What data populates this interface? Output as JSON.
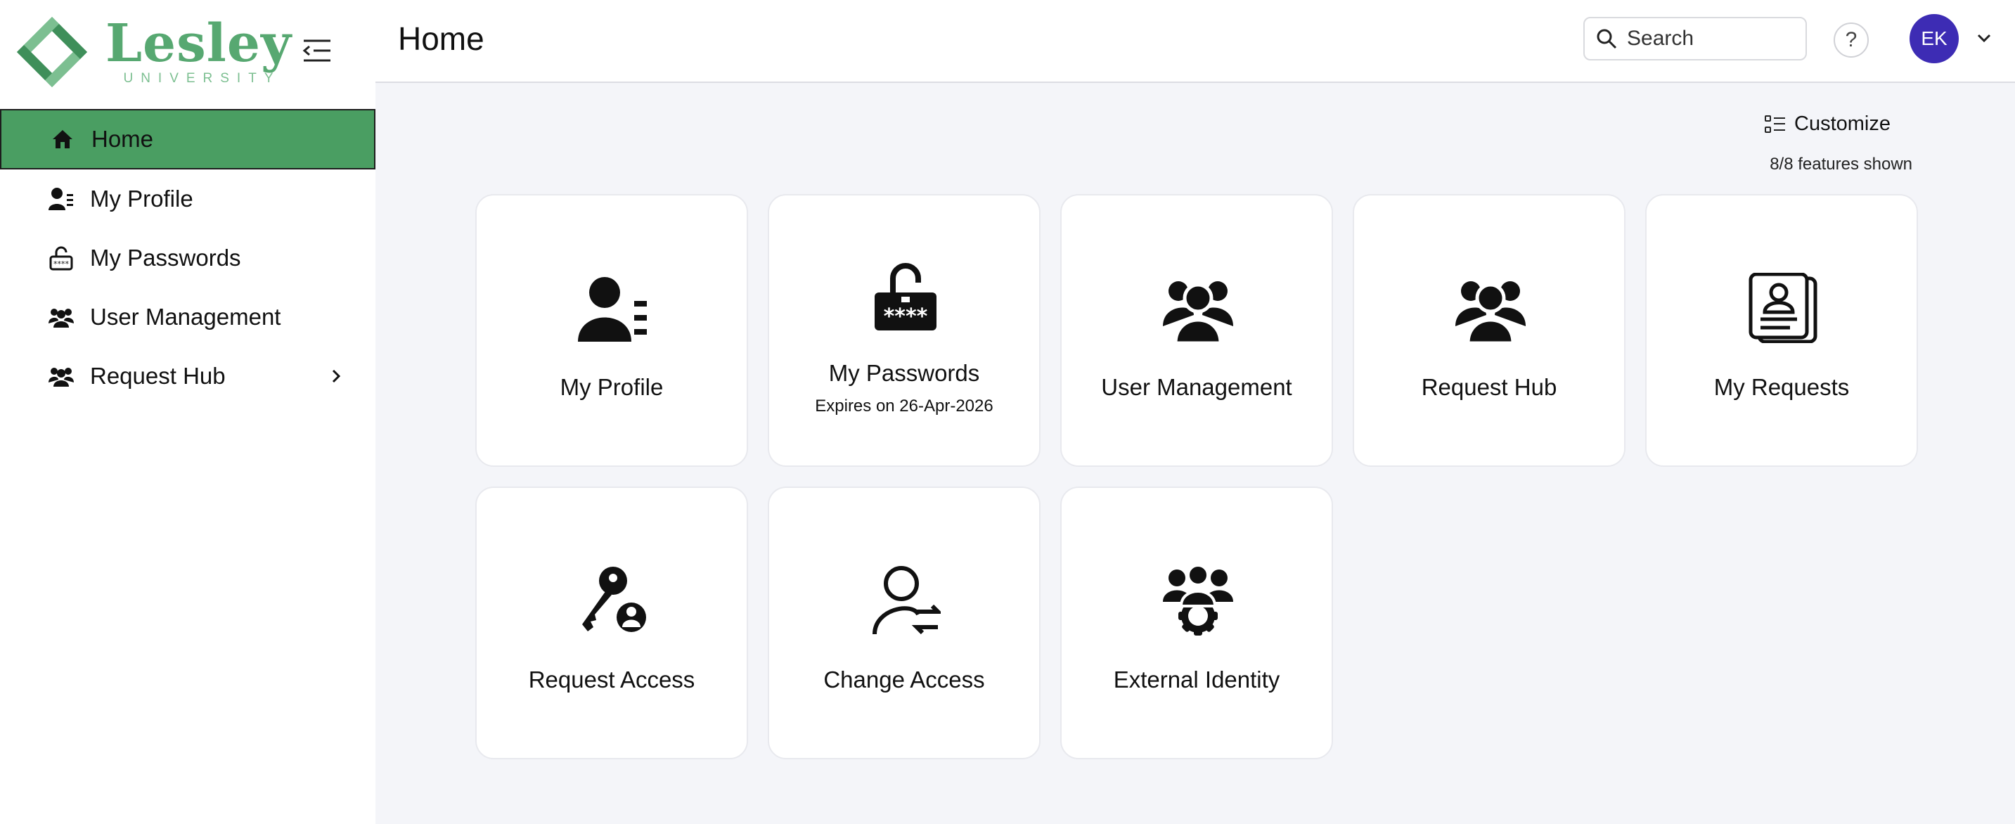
{
  "brand": {
    "name": "Lesley",
    "subtitle": "UNIVERSITY",
    "colors": {
      "primary": "#57a871",
      "active_nav": "#4a9e62",
      "avatar": "#3d2cb4"
    }
  },
  "sidebar": {
    "items": [
      {
        "label": "Home",
        "icon": "home-icon",
        "active": true
      },
      {
        "label": "My Profile",
        "icon": "profile-icon"
      },
      {
        "label": "My Passwords",
        "icon": "password-icon"
      },
      {
        "label": "User Management",
        "icon": "users-icon"
      },
      {
        "label": "Request Hub",
        "icon": "users-icon",
        "expandable": true
      }
    ]
  },
  "header": {
    "title": "Home",
    "search_placeholder": "Search",
    "help_label": "?",
    "user_initials": "EK"
  },
  "main": {
    "customize_label": "Customize",
    "features_shown": "8/8 features shown",
    "tiles": [
      {
        "label": "My Profile",
        "icon": "profile-icon"
      },
      {
        "label": "My Passwords",
        "sub": "Expires on 26-Apr-2026",
        "icon": "unlocked-password-icon"
      },
      {
        "label": "User Management",
        "icon": "users-icon"
      },
      {
        "label": "Request Hub",
        "icon": "users-icon"
      },
      {
        "label": "My Requests",
        "icon": "requests-card-icon"
      },
      {
        "label": "Request Access",
        "icon": "key-user-icon"
      },
      {
        "label": "Change Access",
        "icon": "user-swap-icon"
      },
      {
        "label": "External Identity",
        "icon": "users-gear-icon"
      }
    ]
  }
}
